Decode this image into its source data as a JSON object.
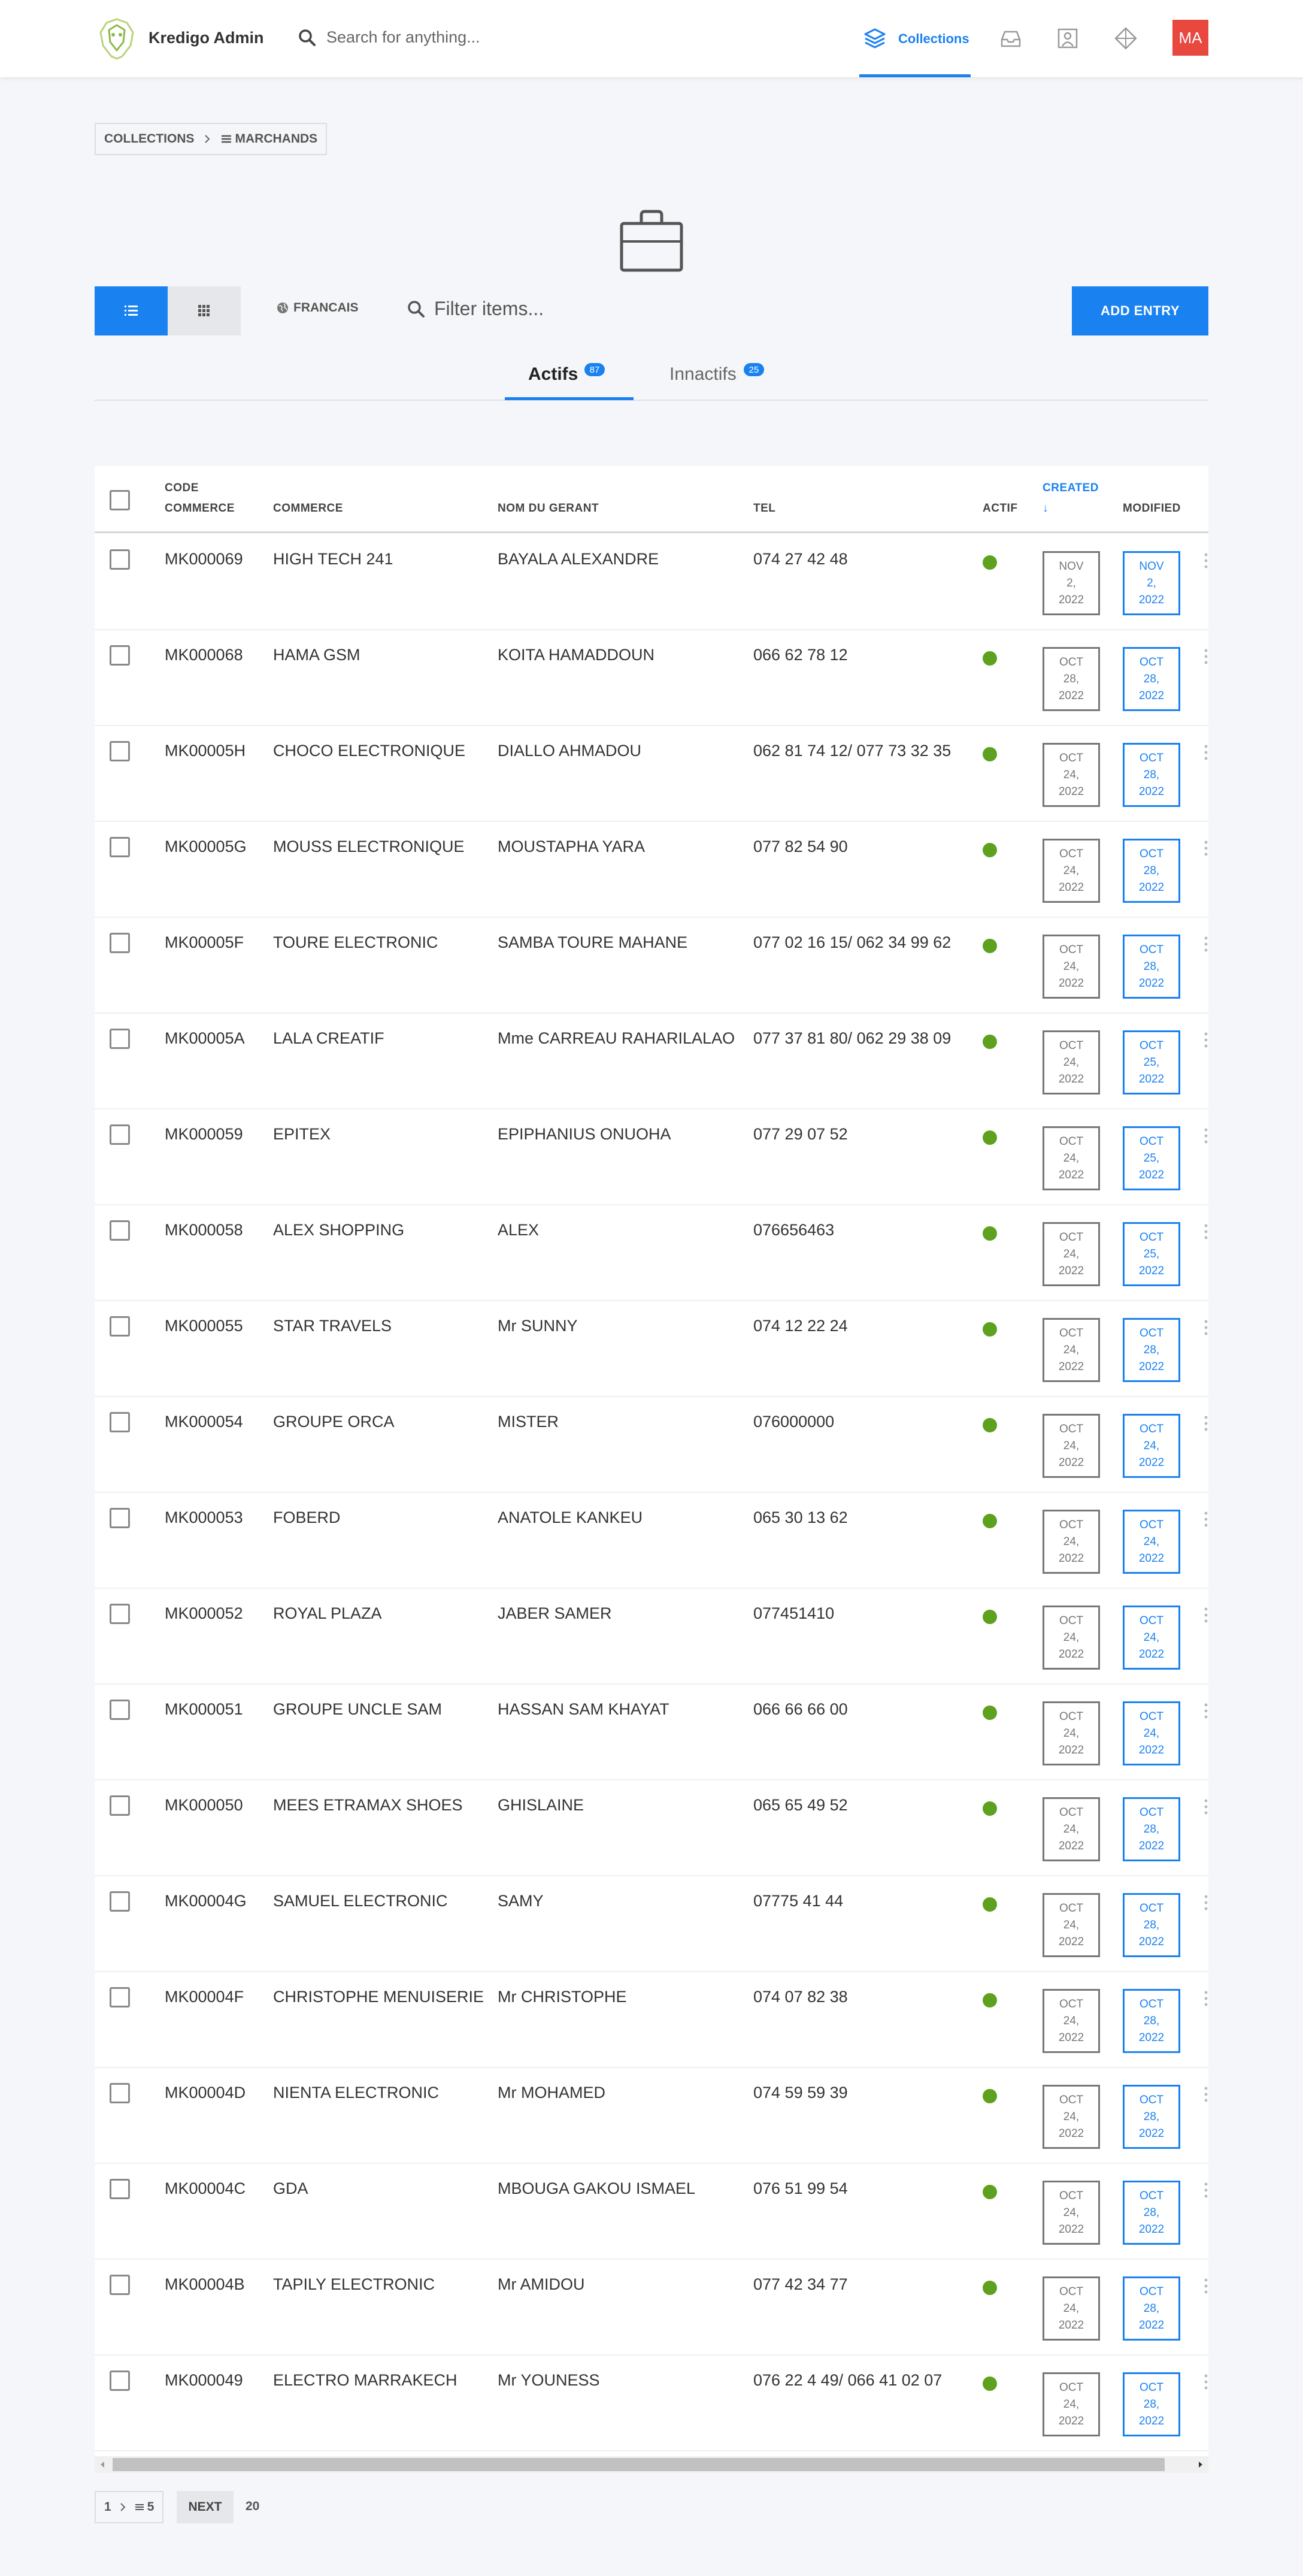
{
  "app": {
    "title": "Kredigo Admin",
    "search_placeholder": "Search for anything...",
    "avatar_initials": "MA"
  },
  "nav": {
    "collections_label": "Collections"
  },
  "breadcrumb": {
    "root": "COLLECTIONS",
    "current": "MARCHANDS"
  },
  "toolbar": {
    "language": "FRANCAIS",
    "filter_placeholder": "Filter items...",
    "add_entry": "ADD ENTRY"
  },
  "tabs": [
    {
      "label": "Actifs",
      "count": "87"
    },
    {
      "label": "Innactifs",
      "count": "25"
    }
  ],
  "columns": {
    "code_line1": "CODE",
    "code_line2": "COMMERCE",
    "commerce": "COMMERCE",
    "gerant": "NOM DU GERANT",
    "tel": "TEL",
    "actif": "ACTIF",
    "created": "CREATED",
    "created_sort": "↓",
    "modified": "MODIFIED"
  },
  "colors": {
    "accent": "#1a82f0",
    "active_dot": "#5da11e",
    "avatar": "#e9483f"
  },
  "rows": [
    {
      "code": "MK000069",
      "commerce": "HIGH TECH 241",
      "gerant": "BAYALA ALEXANDRE",
      "tel": "074 27 42 48",
      "created": [
        "NOV",
        "2,",
        "2022"
      ],
      "modified": [
        "NOV",
        "2,",
        "2022"
      ]
    },
    {
      "code": "MK000068",
      "commerce": "HAMA GSM",
      "gerant": "KOITA HAMADDOUN",
      "tel": "066 62 78 12",
      "created": [
        "OCT",
        "28,",
        "2022"
      ],
      "modified": [
        "OCT",
        "28,",
        "2022"
      ]
    },
    {
      "code": "MK00005H",
      "commerce": "CHOCO ELECTRONIQUE",
      "gerant": "DIALLO AHMADOU",
      "tel": "062 81 74 12/ 077 73 32 35",
      "created": [
        "OCT",
        "24,",
        "2022"
      ],
      "modified": [
        "OCT",
        "28,",
        "2022"
      ]
    },
    {
      "code": "MK00005G",
      "commerce": "MOUSS ELECTRONIQUE",
      "gerant": "MOUSTAPHA YARA",
      "tel": "077 82 54 90",
      "created": [
        "OCT",
        "24,",
        "2022"
      ],
      "modified": [
        "OCT",
        "28,",
        "2022"
      ]
    },
    {
      "code": "MK00005F",
      "commerce": "TOURE ELECTRONIC",
      "gerant": "SAMBA TOURE MAHANE",
      "tel": "077 02 16 15/ 062 34 99 62",
      "created": [
        "OCT",
        "24,",
        "2022"
      ],
      "modified": [
        "OCT",
        "28,",
        "2022"
      ]
    },
    {
      "code": "MK00005A",
      "commerce": "LALA CREATIF",
      "gerant": "Mme CARREAU RAHARILALAO",
      "tel": "077 37 81 80/ 062 29 38 09",
      "created": [
        "OCT",
        "24,",
        "2022"
      ],
      "modified": [
        "OCT",
        "25,",
        "2022"
      ]
    },
    {
      "code": "MK000059",
      "commerce": "EPITEX",
      "gerant": "EPIPHANIUS ONUOHA",
      "tel": "077 29 07 52",
      "created": [
        "OCT",
        "24,",
        "2022"
      ],
      "modified": [
        "OCT",
        "25,",
        "2022"
      ]
    },
    {
      "code": "MK000058",
      "commerce": "ALEX SHOPPING",
      "gerant": "ALEX",
      "tel": "076656463",
      "created": [
        "OCT",
        "24,",
        "2022"
      ],
      "modified": [
        "OCT",
        "25,",
        "2022"
      ]
    },
    {
      "code": "MK000055",
      "commerce": "STAR TRAVELS",
      "gerant": "Mr SUNNY",
      "tel": "074 12 22 24",
      "created": [
        "OCT",
        "24,",
        "2022"
      ],
      "modified": [
        "OCT",
        "28,",
        "2022"
      ]
    },
    {
      "code": "MK000054",
      "commerce": "GROUPE ORCA",
      "gerant": "MISTER",
      "tel": "076000000",
      "created": [
        "OCT",
        "24,",
        "2022"
      ],
      "modified": [
        "OCT",
        "24,",
        "2022"
      ]
    },
    {
      "code": "MK000053",
      "commerce": "FOBERD",
      "gerant": "ANATOLE KANKEU",
      "tel": "065 30 13 62",
      "created": [
        "OCT",
        "24,",
        "2022"
      ],
      "modified": [
        "OCT",
        "24,",
        "2022"
      ]
    },
    {
      "code": "MK000052",
      "commerce": "ROYAL PLAZA",
      "gerant": "JABER SAMER",
      "tel": "077451410",
      "created": [
        "OCT",
        "24,",
        "2022"
      ],
      "modified": [
        "OCT",
        "24,",
        "2022"
      ]
    },
    {
      "code": "MK000051",
      "commerce": "GROUPE UNCLE SAM",
      "gerant": "HASSAN SAM KHAYAT",
      "tel": "066 66 66 00",
      "created": [
        "OCT",
        "24,",
        "2022"
      ],
      "modified": [
        "OCT",
        "24,",
        "2022"
      ]
    },
    {
      "code": "MK000050",
      "commerce": "MEES ETRAMAX SHOES",
      "gerant": "GHISLAINE",
      "tel": "065 65 49 52",
      "created": [
        "OCT",
        "24,",
        "2022"
      ],
      "modified": [
        "OCT",
        "28,",
        "2022"
      ]
    },
    {
      "code": "MK00004G",
      "commerce": "SAMUEL ELECTRONIC",
      "gerant": "SAMY",
      "tel": "07775 41 44",
      "created": [
        "OCT",
        "24,",
        "2022"
      ],
      "modified": [
        "OCT",
        "28,",
        "2022"
      ]
    },
    {
      "code": "MK00004F",
      "commerce": "CHRISTOPHE MENUISERIE",
      "gerant": "Mr CHRISTOPHE",
      "tel": "074 07 82 38",
      "created": [
        "OCT",
        "24,",
        "2022"
      ],
      "modified": [
        "OCT",
        "28,",
        "2022"
      ]
    },
    {
      "code": "MK00004D",
      "commerce": "NIENTA ELECTRONIC",
      "gerant": "Mr MOHAMED",
      "tel": "074 59 59 39",
      "created": [
        "OCT",
        "24,",
        "2022"
      ],
      "modified": [
        "OCT",
        "28,",
        "2022"
      ]
    },
    {
      "code": "MK00004C",
      "commerce": "GDA",
      "gerant": "MBOUGA GAKOU ISMAEL",
      "tel": "076 51 99 54",
      "created": [
        "OCT",
        "24,",
        "2022"
      ],
      "modified": [
        "OCT",
        "28,",
        "2022"
      ]
    },
    {
      "code": "MK00004B",
      "commerce": "TAPILY ELECTRONIC",
      "gerant": "Mr AMIDOU",
      "tel": "077 42 34 77",
      "created": [
        "OCT",
        "24,",
        "2022"
      ],
      "modified": [
        "OCT",
        "28,",
        "2022"
      ]
    },
    {
      "code": "MK000049",
      "commerce": "ELECTRO MARRAKECH",
      "gerant": "Mr YOUNESS",
      "tel": "076 22 4 49/ 066 41 02 07",
      "created": [
        "OCT",
        "24,",
        "2022"
      ],
      "modified": [
        "OCT",
        "28,",
        "2022"
      ]
    }
  ],
  "pagination": {
    "current_page": "1",
    "total_pages": "5",
    "next_label": "NEXT",
    "per_page": "20"
  }
}
